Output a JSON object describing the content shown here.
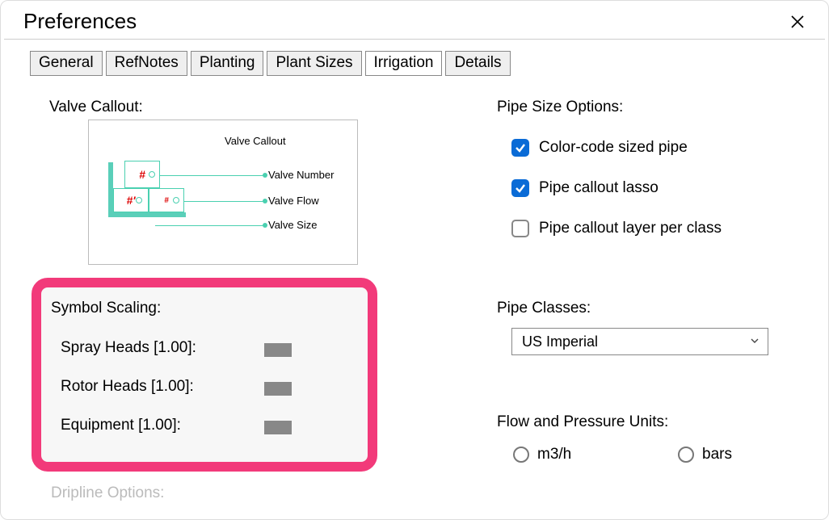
{
  "window": {
    "title": "Preferences"
  },
  "tabs": {
    "items": [
      "General",
      "RefNotes",
      "Planting",
      "Plant Sizes",
      "Irrigation",
      "Details"
    ],
    "active": "Irrigation"
  },
  "valve_callout": {
    "label": "Valve Callout:",
    "preview": {
      "title": "Valve Callout",
      "row_number": "Valve Number",
      "row_flow": "Valve Flow",
      "row_size": "Valve Size",
      "hash": "#",
      "hash_prime": "#'",
      "hash_small": "#"
    }
  },
  "symbol_scaling": {
    "label": "Symbol Scaling:",
    "rows": [
      {
        "label": "Spray Heads [1.00]:"
      },
      {
        "label": "Rotor Heads [1.00]:"
      },
      {
        "label": "Equipment [1.00]:"
      }
    ]
  },
  "dripline": {
    "label": "Dripline Options:"
  },
  "pipe_size_options": {
    "label": "Pipe Size Options:",
    "items": [
      {
        "label": "Color-code sized pipe",
        "checked": true
      },
      {
        "label": "Pipe callout lasso",
        "checked": true
      },
      {
        "label": "Pipe callout layer per class",
        "checked": false
      }
    ]
  },
  "pipe_classes": {
    "label": "Pipe Classes:",
    "selected": "US Imperial"
  },
  "flow_pressure": {
    "label": "Flow and Pressure Units:",
    "flow": "m3/h",
    "pressure": "bars"
  }
}
